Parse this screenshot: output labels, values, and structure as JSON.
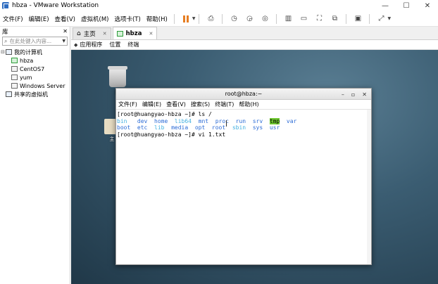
{
  "window": {
    "title": "hbza - VMware Workstation",
    "controls": [
      "—",
      "☐",
      "✕"
    ]
  },
  "menubar": {
    "items": [
      "文件(F)",
      "编辑(E)",
      "查看(V)",
      "虚拟机(M)",
      "选项卡(T)",
      "帮助(H)"
    ]
  },
  "library": {
    "title": "库",
    "close": "✕",
    "search_placeholder": "在此处键入内容...",
    "tree": {
      "root": "我的计算机",
      "vms": [
        "hbza",
        "CentOS7",
        "yum",
        "Windows Server"
      ],
      "shared": "共享的虚拟机"
    }
  },
  "tabs": [
    {
      "label": "主页",
      "close": "✕"
    },
    {
      "label": "hbza",
      "close": "✕"
    }
  ],
  "guest_topbar": {
    "items": [
      "应用程序",
      "位置",
      "终端"
    ]
  },
  "desktop": {
    "trash_label": "回",
    "home_label": "主"
  },
  "terminal": {
    "title": "root@hbza:~",
    "controls": [
      "–",
      "▫",
      "✕"
    ],
    "menu": [
      "文件(F)",
      "编辑(E)",
      "查看(V)",
      "搜索(S)",
      "终端(T)",
      "帮助(H)"
    ],
    "prompt": "[root@huangyao-hbza ~]#",
    "cmd1": " ls /",
    "ls_row1": [
      "bin",
      "dev",
      "home",
      "lib64",
      "mnt",
      "proc",
      "run",
      "srv",
      "tmp",
      "var"
    ],
    "ls_row2": [
      "boot",
      "etc",
      "lib",
      "media",
      "opt",
      "root",
      "sbin",
      "sys",
      "usr"
    ],
    "cmd2": " vi 1.txt"
  }
}
